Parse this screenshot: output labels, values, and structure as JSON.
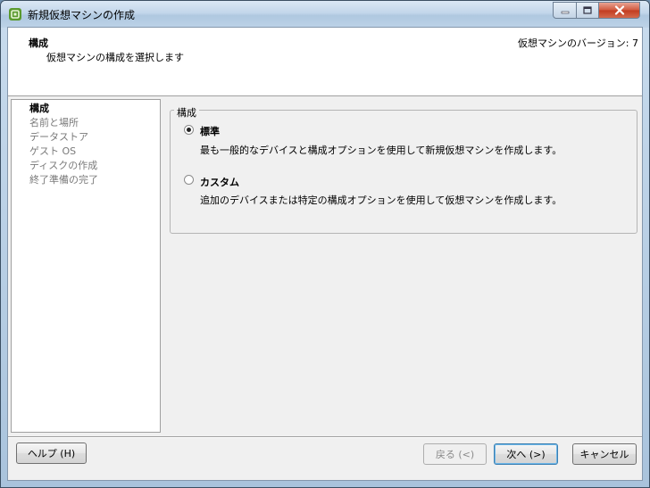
{
  "window": {
    "title": "新規仮想マシンの作成",
    "controls": {
      "minimize_icon": "minimize-icon",
      "maximize_icon": "maximize-icon",
      "close_icon": "close-icon"
    }
  },
  "header": {
    "title": "構成",
    "subtitle": "仮想マシンの構成を選択します",
    "version": "仮想マシンのバージョン: 7"
  },
  "steps": [
    {
      "label": "構成",
      "active": true
    },
    {
      "label": "名前と場所",
      "active": false
    },
    {
      "label": "データストア",
      "active": false
    },
    {
      "label": "ゲスト OS",
      "active": false
    },
    {
      "label": "ディスクの作成",
      "active": false
    },
    {
      "label": "終了準備の完了",
      "active": false
    }
  ],
  "config_group": {
    "legend": "構成",
    "options": [
      {
        "label": "標準",
        "description": "最も一般的なデバイスと構成オプションを使用して新規仮想マシンを作成します。",
        "selected": true
      },
      {
        "label": "カスタム",
        "description": "追加のデバイスまたは特定の構成オプションを使用して仮想マシンを作成します。",
        "selected": false
      }
    ]
  },
  "buttons": {
    "help": "ヘルプ (H)",
    "back": "戻る (<)",
    "next": "次へ (>)",
    "cancel": "キャンセル"
  },
  "colors": {
    "title_bar": "#c2d6ea",
    "close_button": "#c23b1f",
    "default_button_border": "#3c7fb1"
  }
}
